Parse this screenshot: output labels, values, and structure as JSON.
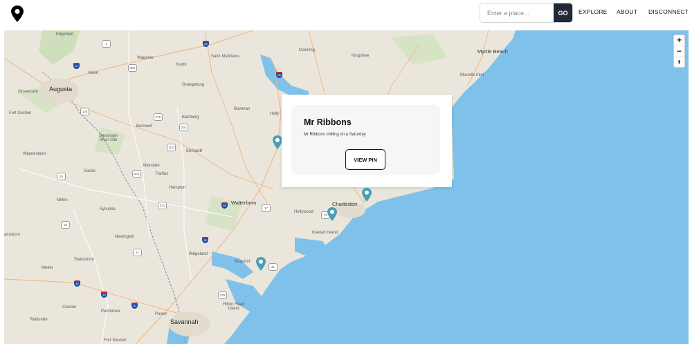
{
  "navbar": {
    "search": {
      "placeholder": "Enter a place...",
      "value": "",
      "go_label": "GO"
    },
    "links": {
      "explore": "EXPLORE",
      "about": "ABOUT",
      "disconnect": "DISCONNECT"
    }
  },
  "map": {
    "labels": {
      "edgefield": "Edgefield",
      "wagener": "Wagener",
      "saint_matthews": "Saint Matthews",
      "manning": "Manning",
      "kingstree": "Kingstree",
      "myrtle_beach": "Myrtle Beach",
      "aiken": "Aiken",
      "north": "North",
      "murrells_inlet": "Murrells Inlet",
      "grovetown": "Grovetown",
      "augusta": "Augusta",
      "orangeburg": "Orangeburg",
      "fort_gordon": "Fort Gordon",
      "bowman": "Bowman",
      "holly": "Holly",
      "bamberg": "Bamberg",
      "barnwell": "Barnwell",
      "savannah_river_site": "Savannah\nRiver Site",
      "ehrhardt": "Ehrhardt",
      "waynesboro": "Waynesboro",
      "allendale": "Allendale",
      "fairfax": "Fairfax",
      "sardis": "Sardis",
      "hampton": "Hampton",
      "walterboro": "Walterboro",
      "millen": "Millen",
      "sylvania": "Sylvania",
      "charleston": "Charleston",
      "hollywood": "Hollywood",
      "kiawah_island": "Kiawah Island",
      "newington": "Newington",
      "ainsboro": "ainsboro",
      "ridgeland": "Ridgeland",
      "beaufort": "Beaufort",
      "statesboro": "Statesboro",
      "metter": "Metter",
      "hilton_head_island": "Hilton Head\nIsland",
      "claxton": "Claxton",
      "pembroke": "Pembroke",
      "pooler": "Pooler",
      "reidsville": "Reidsville",
      "savannah": "Savannah",
      "fort_stewart": "Fort Stewart"
    },
    "shields": {
      "s1": "1",
      "s302": "302",
      "s125": "125",
      "s278": "278",
      "s301a": "301",
      "s301b": "301",
      "s301c": "301",
      "s25a": "25",
      "s25b": "25",
      "s321": "321",
      "s21a": "21",
      "s21b": "21",
      "s17": "17",
      "s278b": "278",
      "s70": "70"
    },
    "interstates": {
      "i20a": "20",
      "i20b": "20",
      "i26": "26",
      "i95a": "95",
      "i95b": "95",
      "i95c": "95",
      "i16a": "16",
      "i16b": "16"
    },
    "zoom": {
      "in": "+",
      "out": "−",
      "compass": "⬆"
    }
  },
  "popup": {
    "title": "Mr Ribbons",
    "description": "Mr Ribbons chilling on a Saturday",
    "button": "VIEW PIN"
  },
  "colors": {
    "water": "#7fc1e8",
    "land": "#ebe6dc",
    "pin": "#4a9fb8",
    "go_button": "#1f2937"
  }
}
